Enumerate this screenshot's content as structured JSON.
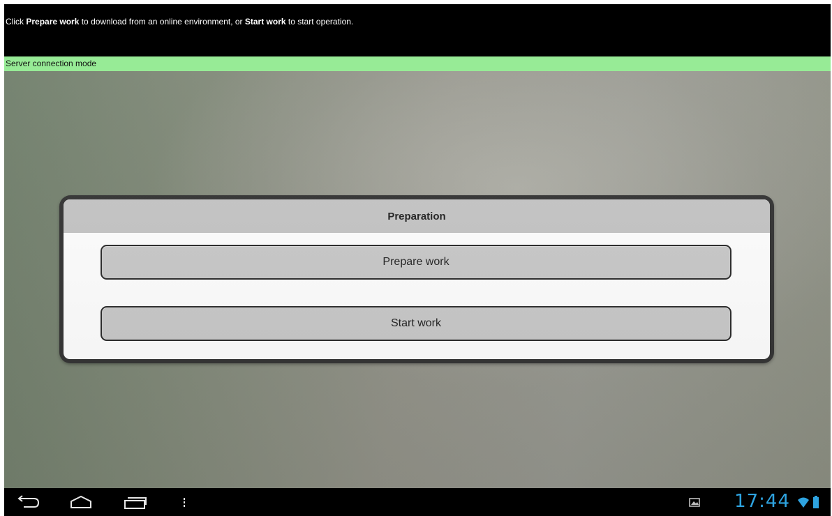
{
  "instruction": {
    "prefix": "Click ",
    "prepare_strong": "Prepare work",
    "middle": " to download from an online environment, or ",
    "start_strong": "Start work",
    "suffix": " to start operation."
  },
  "mode_bar": {
    "label": "Server connection mode",
    "color": "#97eb96"
  },
  "dialog": {
    "title": "Preparation",
    "prepare_button": "Prepare work",
    "start_button": "Start work"
  },
  "system_bar": {
    "icons": [
      "back-icon",
      "home-icon",
      "recent-apps-icon",
      "menu-icon"
    ],
    "status_icons": [
      "gallery-notification-icon",
      "wifi-icon",
      "battery-icon"
    ],
    "time": "17:44",
    "clock_color": "#2ea3e0"
  }
}
